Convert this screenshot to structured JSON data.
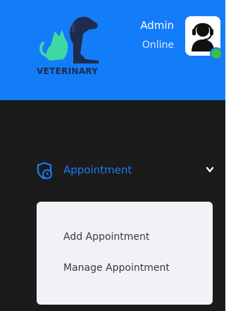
{
  "brand": {
    "logo_text": "VETERINARY"
  },
  "user": {
    "name": "Admin",
    "status": "Online"
  },
  "nav": {
    "items": [
      {
        "label": "Appointment",
        "icon": "shield-clock-icon",
        "expanded": true,
        "children": [
          {
            "label": "Add Appointment"
          },
          {
            "label": "Manage Appointment"
          }
        ]
      }
    ]
  },
  "colors": {
    "header": "#137cf9",
    "sidebar": "#1b1b1b",
    "accent": "#1b7cf7",
    "online": "#3bbf42",
    "submenu_bg": "#f0f2f5"
  }
}
